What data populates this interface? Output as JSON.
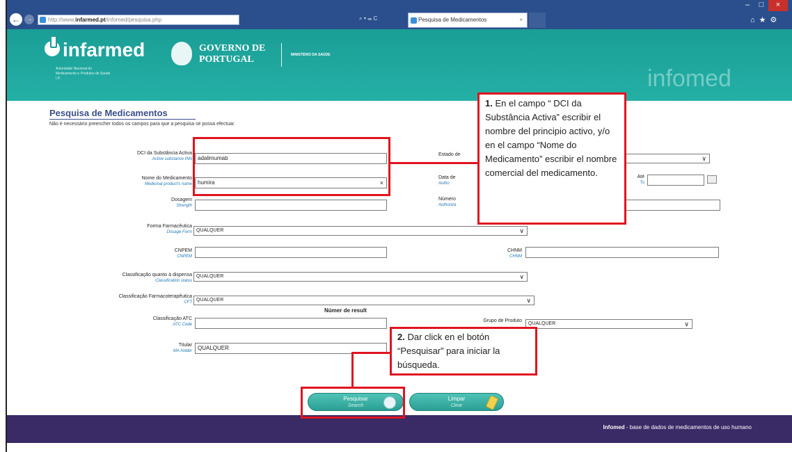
{
  "browser": {
    "url_prefix": "http://www.",
    "url_domain": "infarmed.pt",
    "url_path": "/infomed/pesquisa.php",
    "address_controls": "⌕ ▾ ☰ C",
    "tab_title": "Pesquisa de Medicamentos",
    "tab_close": "×",
    "win_min": "–",
    "win_max": "□",
    "win_close": "×",
    "tools": "⌂★⚙"
  },
  "header": {
    "brand": "infarmed",
    "brand_sub": "Autoridade Nacional do Medicamento e Produtos de Saúde I.P.",
    "gov_line1": "GOVERNO DE",
    "gov_line2": "PORTUGAL",
    "ministry": "MINISTÉRIO DA SAÚDE",
    "site_name": "infomed"
  },
  "page": {
    "title": "Pesquisa de Medicamentos",
    "note": "Não é necessário preencher todos os campos para que a pesquisa se possa efectuar."
  },
  "form": {
    "dci": {
      "label": "DCI da Substância Activa",
      "label_en": "Active substance INN",
      "value": "adalimumab"
    },
    "nome": {
      "label": "Nome do Medicamento",
      "label_en": "Medicinal product's name",
      "value": "humira",
      "clear": "×"
    },
    "dosagem": {
      "label": "Dosagem",
      "label_en": "Strength",
      "value": ""
    },
    "forma": {
      "label": "Forma Farmacêutica",
      "label_en": "Dosage Form",
      "value": "QUALQUER"
    },
    "cnpem": {
      "label": "CNPEM",
      "label_en": "CNPEM",
      "value": ""
    },
    "chnm": {
      "label": "CHNM",
      "label_en": "CHNM",
      "value": ""
    },
    "dispensa": {
      "label": "Classificação quanto à dispensa",
      "label_en": "Classification status",
      "value": "QUALQUER"
    },
    "farmaco": {
      "label": "Classificação Farmacoterapêutica",
      "label_en": "CFT",
      "value": "QUALQUER"
    },
    "atc": {
      "label": "Classificação ATC",
      "label_en": "ATC Code",
      "value": ""
    },
    "grupo": {
      "label": "Grupo de Produto",
      "value": "QUALQUER"
    },
    "titular": {
      "label": "Titular",
      "label_en": "MA holder",
      "value": "QUALQUER"
    },
    "estado": {
      "label": "Estado de"
    },
    "data": {
      "label": "Data de",
      "label_en": "Autho",
      "ate": "Até",
      "ate_en": "To"
    },
    "numero": {
      "label": "Número",
      "label_en": "Authoriza"
    },
    "results_label": "Númer  de result"
  },
  "buttons": {
    "search": {
      "label": "Pesquisar",
      "label_en": "Search"
    },
    "clear": {
      "label": "Limpar",
      "label_en": "Clear"
    }
  },
  "footer": {
    "brand": "Infomed",
    "text": " - base de dados de medicamentos de uso humano"
  },
  "annotations": {
    "callout1_num": "1.",
    "callout1_text": " En el campo “ DCI da Substância Activa” escribir el nombre del principio activo, y/o en el campo “Nome do Medicamento” escribir el nombre comercial del medicamento.",
    "callout2_num": "2.",
    "callout2_text": " Dar click en el botón “Pesquisar” para iniciar la búsqueda.",
    "arrow_glyph": "∨"
  },
  "colors": {
    "header_teal": "#1a9e96",
    "footer_purple": "#3a2a66",
    "annotation_red": "#e0141e"
  }
}
